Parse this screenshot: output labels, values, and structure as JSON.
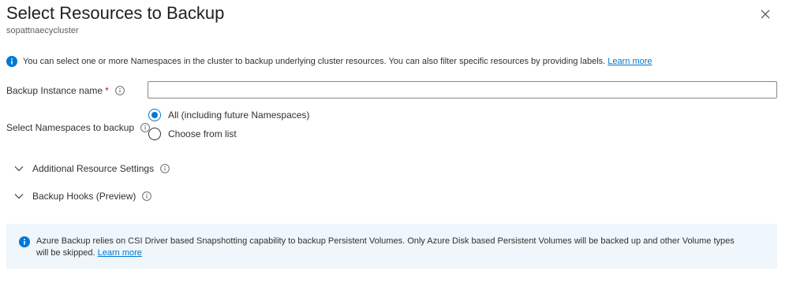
{
  "header": {
    "title": "Select Resources to Backup",
    "subtitle": "sopattnaecycluster"
  },
  "info": {
    "text": "You can select one or more Namespaces in the cluster to backup underlying cluster resources. You can also filter specific resources by providing labels.",
    "link": "Learn more"
  },
  "form": {
    "instance_label": "Backup Instance name",
    "required_mark": "*",
    "instance_value": "",
    "namespaces_label": "Select Namespaces to backup",
    "radio_all": "All (including future Namespaces)",
    "radio_list": "Choose from list",
    "selected": "All (including future Namespaces)"
  },
  "sections": {
    "additional": "Additional Resource Settings",
    "hooks": "Backup Hooks (Preview)"
  },
  "banner": {
    "text": "Azure Backup relies on CSI Driver based Snapshotting capability to backup Persistent Volumes. Only Azure Disk based Persistent Volumes will be backed up and other Volume types will be skipped.",
    "link": "Learn more"
  },
  "colors": {
    "accent": "#0078d4",
    "banner_bg": "#eff6fc",
    "required": "#a4262c"
  },
  "icons": {
    "close": "close-icon",
    "info": "info-icon",
    "help": "help-circle-icon",
    "chevron": "chevron-down-icon"
  }
}
